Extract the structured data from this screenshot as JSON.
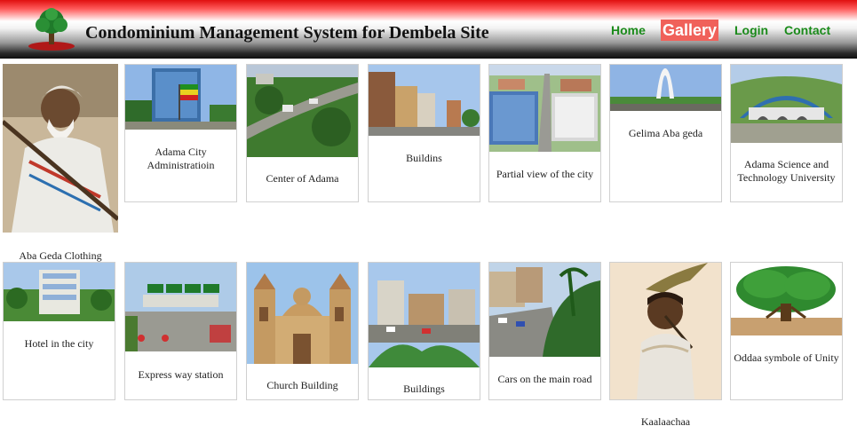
{
  "header": {
    "title": "Condominium Management System for Dembela Site",
    "logo_icon": "tree-emblem-icon"
  },
  "nav": {
    "home": "Home",
    "gallery": "Gallery",
    "login": "Login",
    "contact": "Contact",
    "active": "Gallery",
    "link_color": "#1a8a1a",
    "active_bg": "#f0615a"
  },
  "gallery": {
    "row1": [
      "Aba Geda Clothing",
      "Adama City Administratioin",
      "Center of Adama",
      "Buildins",
      "Partial view of the city",
      "Gelima Aba geda",
      "Adama Science and Technology University"
    ],
    "row2": [
      "Hotel in the city",
      "Express way station",
      "Church Building",
      "Buildings",
      "Cars on the main road",
      "Kaalaachaa",
      "Oddaa symbole of Unity"
    ]
  }
}
